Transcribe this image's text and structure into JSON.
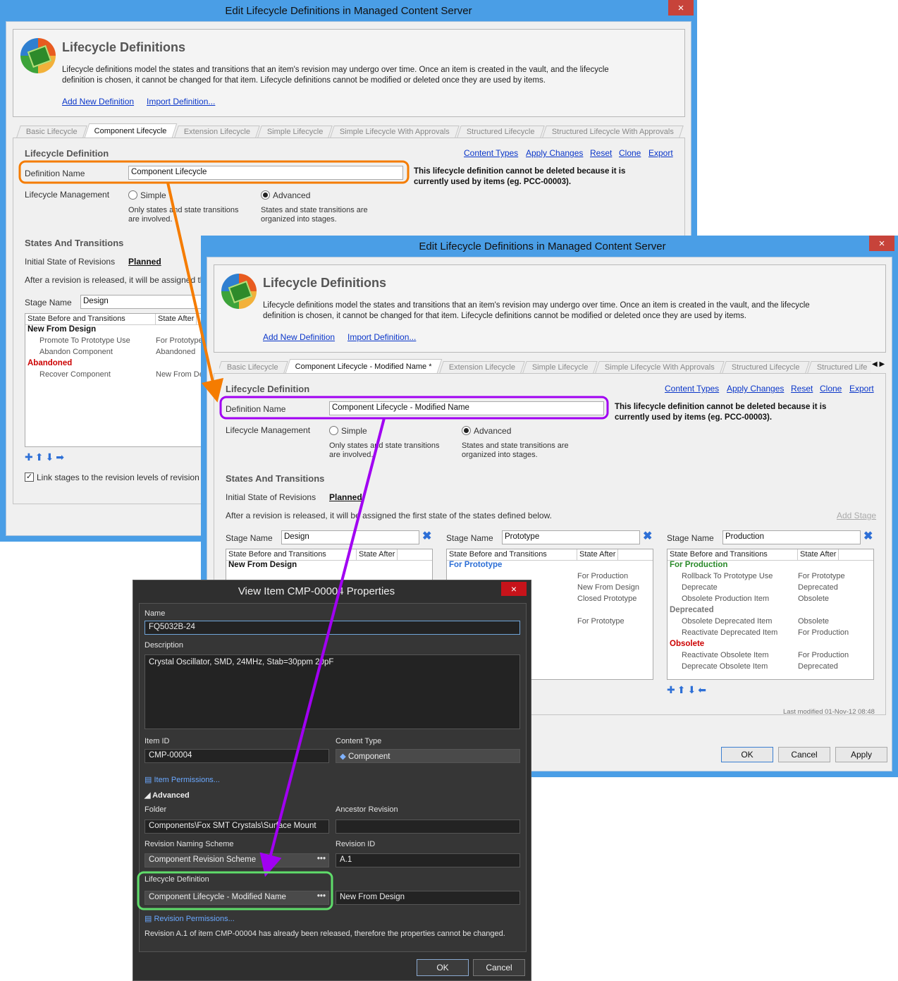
{
  "win1": {
    "title": "Edit Lifecycle Definitions in Managed Content Server",
    "close": "×",
    "header": {
      "title": "Lifecycle Definitions",
      "description": "Lifecycle definitions model the states and transitions that an item's revision may undergo over time. Once an item is created in the vault, and the lifecycle definition is chosen, it cannot be changed for that item. Lifecycle definitions cannot be modified or deleted once they are used by items.",
      "add_link": "Add New Definition",
      "import_link": "Import Definition..."
    },
    "tabs": [
      "Basic Lifecycle",
      "Component Lifecycle",
      "Extension Lifecycle",
      "Simple Lifecycle",
      "Simple Lifecycle With Approvals",
      "Structured Lifecycle",
      "Structured Lifecycle With Approvals"
    ],
    "section_title": "Lifecycle Definition",
    "actions": [
      "Content Types",
      "Apply Changes",
      "Reset",
      "Clone",
      "Export"
    ],
    "def_name_label": "Definition Name",
    "def_name_value": "Component Lifecycle",
    "note": "This lifecycle definition cannot be deleted because it is currently used by items (eg. PCC-00003).",
    "mgmt_label": "Lifecycle Management",
    "simple_label": "Simple",
    "simple_desc": "Only states and state transitions are involved.",
    "advanced_label": "Advanced",
    "advanced_desc": "States and state transitions are organized into stages.",
    "states_title": "States And Transitions",
    "initial_label": "Initial State of Revisions",
    "initial_value": "Planned",
    "after_text": "After a revision is released, it will be assigned the",
    "stage_label": "Stage Name",
    "stage_value": "Design",
    "grid_h1": "State Before and Transitions",
    "grid_h2": "State After",
    "grid": [
      {
        "state": "New From Design",
        "color": "#111111"
      },
      {
        "t": "Promote To Prototype Use",
        "a": "For Prototype"
      },
      {
        "t": "Abandon Component",
        "a": "Abandoned"
      },
      {
        "state": "Abandoned",
        "color": "#cc0000"
      },
      {
        "t": "Recover Component",
        "a": "New From De"
      }
    ],
    "link_stages": "Link stages to the revision levels of revision n"
  },
  "win2": {
    "title": "Edit Lifecycle Definitions in Managed Content Server",
    "close": "×",
    "header": {
      "title": "Lifecycle Definitions",
      "description": "Lifecycle definitions model the states and transitions that an item's revision may undergo over time. Once an item is created in the vault, and the lifecycle definition is chosen, it cannot be changed for that item. Lifecycle definitions cannot be modified or deleted once they are used by items.",
      "add_link": "Add New Definition",
      "import_link": "Import Definition..."
    },
    "tabs": [
      "Basic Lifecycle",
      "Component Lifecycle - Modified Name *",
      "Extension Lifecycle",
      "Simple Lifecycle",
      "Simple Lifecycle With Approvals",
      "Structured Lifecycle",
      "Structured Life"
    ],
    "section_title": "Lifecycle Definition",
    "actions": [
      "Content Types",
      "Apply Changes",
      "Reset",
      "Clone",
      "Export"
    ],
    "def_name_label": "Definition Name",
    "def_name_value": "Component Lifecycle - Modified Name",
    "note": "This lifecycle definition cannot be deleted because it is currently used by items (eg. PCC-00003).",
    "mgmt_label": "Lifecycle Management",
    "simple_label": "Simple",
    "simple_desc": "Only states and state transitions are involved.",
    "advanced_label": "Advanced",
    "advanced_desc": "States and state transitions are organized into stages.",
    "states_title": "States And Transitions",
    "initial_label": "Initial State of Revisions",
    "initial_value": "Planned",
    "after_text": "After a revision is released, it will be assigned the first state of the states defined below.",
    "add_stage": "Add Stage",
    "stage_label": "Stage Name",
    "stages": [
      {
        "name": "Design",
        "rows": [
          {
            "state": "New From Design",
            "color": "#111111"
          }
        ]
      },
      {
        "name": "Prototype",
        "rows": [
          {
            "state": "For Prototype",
            "color": "#2d6fd6"
          },
          {
            "t": "",
            "a": "For Production"
          },
          {
            "t": "",
            "a": "New From Design"
          },
          {
            "t": "",
            "a": "Closed Prototype"
          },
          {
            "t": "",
            "a": ""
          },
          {
            "t": "",
            "a": "For Prototype"
          }
        ]
      },
      {
        "name": "Production",
        "rows": [
          {
            "state": "For Production",
            "color": "#2a8a2a"
          },
          {
            "t": "Rollback To Prototype Use",
            "a": "For Prototype"
          },
          {
            "t": "Deprecate",
            "a": "Deprecated"
          },
          {
            "t": "Obsolete Production Item",
            "a": "Obsolete"
          },
          {
            "state": "Deprecated",
            "color": "#777777"
          },
          {
            "t": "Obsolete Deprecated Item",
            "a": "Obsolete"
          },
          {
            "t": "Reactivate Deprecated Item",
            "a": "For Production"
          },
          {
            "state": "Obsolete",
            "color": "#cc0000"
          },
          {
            "t": "Reactivate Obsolete Item",
            "a": "For Production"
          },
          {
            "t": "Deprecate Obsolete Item",
            "a": "Deprecated"
          }
        ]
      }
    ],
    "last_modified": "Last modified 01-Nov-12 08:48",
    "ok": "OK",
    "cancel": "Cancel",
    "apply": "Apply"
  },
  "dlg": {
    "title": "View Item CMP-00004 Properties",
    "close": "×",
    "name_label": "Name",
    "name_value": "FQ5032B-24",
    "desc_label": "Description",
    "desc_value": "Crystal Oscillator, SMD, 24MHz, Stab=30ppm 20pF",
    "itemid_label": "Item ID",
    "itemid_value": "CMP-00004",
    "ctype_label": "Content Type",
    "ctype_value": "Component",
    "item_perm": "Item Permissions...",
    "advanced": "Advanced",
    "folder_label": "Folder",
    "folder_value": "Components\\Fox SMT Crystals\\Surface Mount",
    "ancestor_label": "Ancestor Revision",
    "ancestor_value": "",
    "naming_label": "Revision Naming Scheme",
    "naming_value": "Component Revision Scheme",
    "revid_label": "Revision ID",
    "revid_value": "A.1",
    "lc_label": "Lifecycle Definition",
    "lc_value": "Component Lifecycle - Modified Name",
    "state_value": "New From Design",
    "rev_perm": "Revision Permissions...",
    "released_note": "Revision A.1 of item CMP-00004 has already been released, therefore the properties cannot be changed.",
    "ok": "OK",
    "cancel": "Cancel"
  },
  "colors": {
    "orange": "#f57c00",
    "purple": "#a100f2",
    "green": "#5fdc6a",
    "title_blue": "#4a9ee6"
  }
}
